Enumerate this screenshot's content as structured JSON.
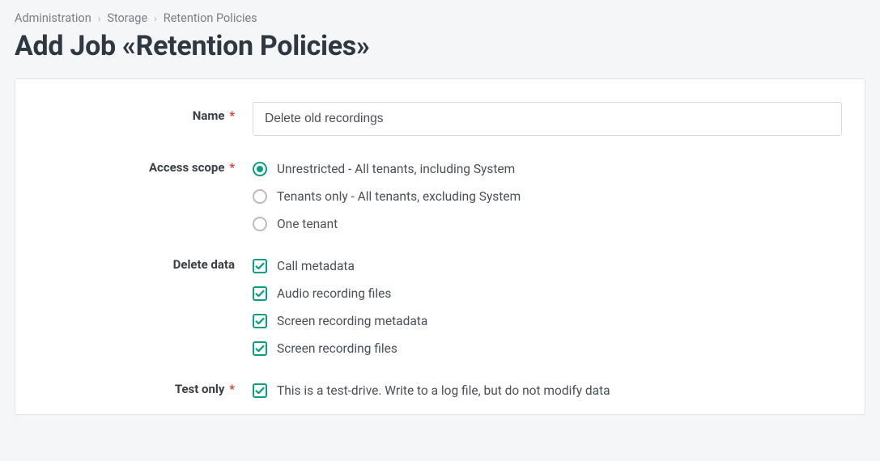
{
  "breadcrumb": {
    "items": [
      "Administration",
      "Storage",
      "Retention Policies"
    ]
  },
  "page_title": "Add Job «Retention Policies»",
  "fields": {
    "name": {
      "label": "Name",
      "required": true,
      "value": "Delete old recordings"
    },
    "access_scope": {
      "label": "Access scope",
      "required": true,
      "options": [
        {
          "label": "Unrestricted - All tenants, including System",
          "checked": true
        },
        {
          "label": "Tenants only - All tenants, excluding System",
          "checked": false
        },
        {
          "label": "One tenant",
          "checked": false
        }
      ]
    },
    "delete_data": {
      "label": "Delete data",
      "required": false,
      "options": [
        {
          "label": "Call metadata",
          "checked": true
        },
        {
          "label": "Audio recording files",
          "checked": true
        },
        {
          "label": "Screen recording metadata",
          "checked": true
        },
        {
          "label": "Screen recording files",
          "checked": true
        }
      ]
    },
    "test_only": {
      "label": "Test only",
      "required": true,
      "options": [
        {
          "label": "This is a test-drive. Write to a log file, but do not modify data",
          "checked": true
        }
      ]
    }
  },
  "required_marker": "*"
}
